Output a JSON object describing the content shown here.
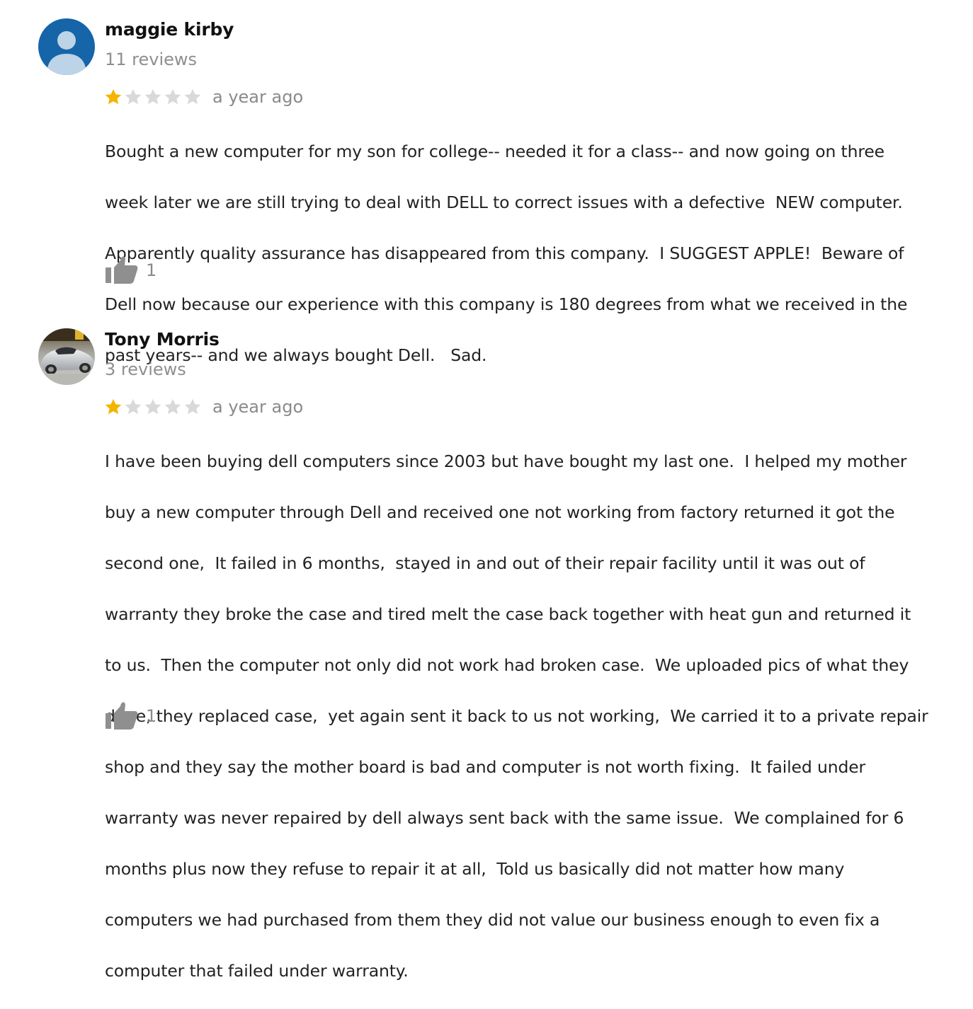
{
  "reviews": [
    {
      "author": "maggie kirby",
      "review_count": "11 reviews",
      "rating": 1,
      "rating_max": 5,
      "date": "a year ago",
      "avatar_icon": "default-person-icon",
      "text_lines": [
        "Bought a new computer for my son for college-- needed it for a class-- and now going on three",
        "week later we are still trying to deal with DELL to correct issues with a defective  NEW computer.",
        "Apparently quality assurance has disappeared from this company.  I SUGGEST APPLE!  Beware of",
        "Dell now because our experience with this company is 180 degrees from what we received in the",
        "past years-- and we always bought Dell.   Sad."
      ],
      "helpful_count": "1"
    },
    {
      "author": "Tony Morris",
      "review_count": "3 reviews",
      "rating": 1,
      "rating_max": 5,
      "date": "a year ago",
      "avatar_icon": "car-photo-avatar",
      "text_lines": [
        "I have been buying dell computers since 2003 but have bought my last one.  I helped my mother",
        "buy a new computer through Dell and received one not working from factory returned it got the",
        "second one,  It failed in 6 months,  stayed in and out of their repair facility until it was out of",
        "warranty they broke the case and tired melt the case back together with heat gun and returned it",
        "to us.  Then the computer not only did not work had broken case.  We uploaded pics of what they",
        "done, they replaced case,  yet again sent it back to us not working,  We carried it to a private repair",
        "shop and they say the mother board is bad and computer is not worth fixing.  It failed under",
        "warranty was never repaired by dell always sent back with the same issue.  We complained for 6",
        "months plus now they refuse to repair it at all,  Told us basically did not matter how many",
        "computers we had purchased from them they did not value our business enough to even fix a",
        "computer that failed under warranty."
      ],
      "helpful_count": "1"
    }
  ],
  "colors": {
    "star_filled": "#F5B400",
    "star_empty": "#D9D9D9",
    "muted_text": "#8A8A8A",
    "thumb_icon": "#8F8F8F",
    "default_avatar_bg": "#1565A8"
  }
}
